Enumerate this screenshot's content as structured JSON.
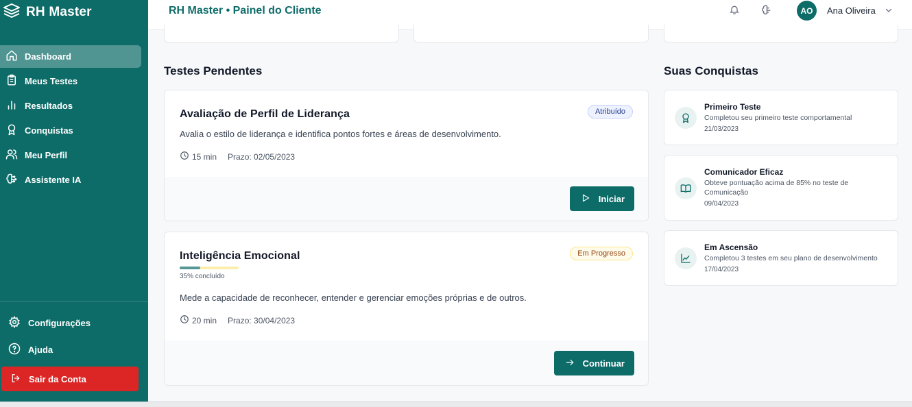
{
  "brand": {
    "name": "RH Master"
  },
  "sidebar": {
    "items": [
      {
        "label": "Dashboard",
        "icon": "home-icon",
        "active": true
      },
      {
        "label": "Meus Testes",
        "icon": "clipboard-icon"
      },
      {
        "label": "Resultados",
        "icon": "bar-chart-icon"
      },
      {
        "label": "Conquistas",
        "icon": "award-icon"
      },
      {
        "label": "Meu Perfil",
        "icon": "users-icon"
      },
      {
        "label": "Assistente IA",
        "icon": "brain-icon"
      }
    ],
    "bottom": [
      {
        "label": "Configurações",
        "icon": "gear-icon"
      },
      {
        "label": "Ajuda",
        "icon": "help-icon"
      }
    ],
    "logout": "Sair da Conta"
  },
  "header": {
    "title": "RH Master • Painel do Cliente",
    "avatar_initials": "AO",
    "user_name": "Ana Oliveira"
  },
  "pending": {
    "title": "Testes Pendentes",
    "tests": [
      {
        "title": "Avaliação de Perfil de Liderança",
        "badge": "Atribuído",
        "description": "Avalia o estilo de liderança e identifica pontos fortes e áreas de desenvolvimento.",
        "duration": "15 min",
        "deadline": "Prazo: 02/05/2023",
        "button": "Iniciar"
      },
      {
        "title": "Inteligência Emocional",
        "badge": "Em Progresso",
        "progress": 0.35,
        "progress_label": "35% concluído",
        "description": "Mede a capacidade de reconhecer, entender e gerenciar emoções próprias e de outros.",
        "duration": "20 min",
        "deadline": "Prazo: 30/04/2023",
        "button": "Continuar"
      }
    ]
  },
  "achievements": {
    "title": "Suas Conquistas",
    "items": [
      {
        "title": "Primeiro Teste",
        "description": "Completou seu primeiro teste comportamental",
        "date": "21/03/2023",
        "icon": "award-icon"
      },
      {
        "title": "Comunicador Eficaz",
        "description": "Obteve pontuação acima de 85% no teste de Comunicação",
        "date": "09/04/2023",
        "icon": "book-icon"
      },
      {
        "title": "Em Ascensão",
        "description": "Completou 3 testes em seu plano de desenvolvimento",
        "date": "17/04/2023",
        "icon": "trending-up-icon"
      }
    ]
  },
  "colors": {
    "primary": "#0d6c68",
    "danger": "#dc2626",
    "background": "#f6f8f9"
  }
}
